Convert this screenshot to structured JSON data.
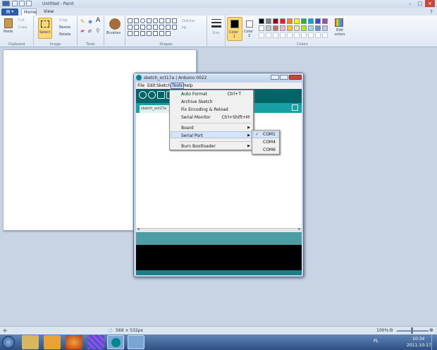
{
  "window": {
    "title": "Untitled - Paint"
  },
  "tabs": {
    "file": "",
    "home": "Home",
    "view": "View"
  },
  "ribbon": {
    "clipboard": {
      "paste": "Paste",
      "cut": "Cut",
      "copy": "Copy",
      "label": "Clipboard"
    },
    "image": {
      "select": "Select",
      "crop": "Crop",
      "resize": "Resize",
      "rotate": "Rotate",
      "label": "Image"
    },
    "tools": {
      "label": "Tools"
    },
    "brushes": {
      "label": "Brushes"
    },
    "shapes": {
      "outline": "Outline",
      "fill": "Fill",
      "label": "Shapes"
    },
    "size": {
      "label": "Size"
    },
    "color1": {
      "label": "Color",
      "num": "1"
    },
    "color2": {
      "label": "Color",
      "num": "2"
    },
    "colors": {
      "label": "Colors",
      "edit": "Edit colors"
    },
    "palette": [
      "#000000",
      "#7f7f7f",
      "#880015",
      "#ed1c24",
      "#ff7f27",
      "#fff200",
      "#22b14c",
      "#00a2e8",
      "#3f48cc",
      "#a349a4",
      "#ffffff",
      "#c3c3c3",
      "#b97a57",
      "#ffaec9",
      "#ffc90e",
      "#efe4b0",
      "#b5e61d",
      "#99d9ea",
      "#7092be",
      "#c8bfe7"
    ]
  },
  "arduino": {
    "title": "sketch_oct17a | Arduino 0022",
    "menus": [
      "File",
      "Edit",
      "Sketch",
      "Tools",
      "Help"
    ],
    "tab": "sketch_oct17a"
  },
  "tools_menu": {
    "items": [
      {
        "label": "Auto Format",
        "shortcut": "Ctrl+T"
      },
      {
        "label": "Archive Sketch",
        "shortcut": ""
      },
      {
        "label": "Fix Encoding & Reload",
        "shortcut": ""
      },
      {
        "label": "Serial Monitor",
        "shortcut": "Ctrl+Shift+M"
      },
      {
        "label": "Board",
        "shortcut": ""
      },
      {
        "label": "Serial Port",
        "shortcut": ""
      },
      {
        "label": "Burn Bootloader",
        "shortcut": ""
      }
    ]
  },
  "serial_submenu": {
    "items": [
      "COM1",
      "COM4",
      "COM6"
    ],
    "checked": "COM1"
  },
  "status": {
    "dims": "569 × 532px",
    "zoom": "100%"
  },
  "taskbar": {
    "lang": "PL",
    "time": "10:34",
    "date": "2011-10-17"
  }
}
